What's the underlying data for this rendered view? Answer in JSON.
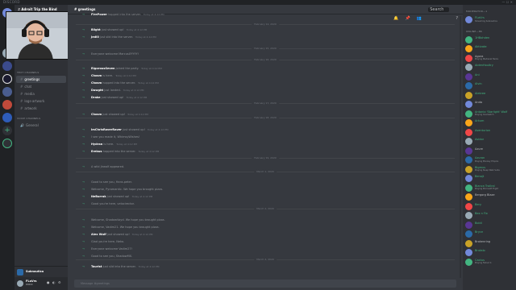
{
  "window": {
    "title": "DISCORD",
    "controls": "— ☐ ✕"
  },
  "server": {
    "name": "ℤ Adroit Trip the Bind"
  },
  "channels": {
    "text_category": "TEXT CHANNELS",
    "text": [
      "greetings",
      "chat",
      "media",
      "logs-artwork",
      "artwork"
    ],
    "voice_category": "VOICE CHANNELS",
    "voice": [
      "General"
    ]
  },
  "now_playing": {
    "name": "Subnautica"
  },
  "user": {
    "name": "FLaVrs",
    "tag": "#0000"
  },
  "chat_header": {
    "channel": "greetings",
    "search_placeholder": "Search"
  },
  "icons": {
    "bell": "bell-icon",
    "pin": "pin-icon",
    "members": "members-icon",
    "help": "help-icon"
  },
  "messages": [
    {
      "user": "FirePower",
      "text": "hopped into the server.",
      "ts": "Today at 4:12 PM"
    },
    {
      "user": "Blight",
      "text": "just showed up!",
      "ts": "Today at 4:12 PM"
    },
    {
      "user": "Jedi0",
      "text": "just slid into the server.",
      "ts": "Today at 4:12 PM"
    },
    {
      "user": "",
      "text": "Everyone welcome MarcusXYYYY!",
      "ts": ""
    },
    {
      "user": "RigorousSeven",
      "text": "joined the party.",
      "ts": "Today at 4:12 PM"
    },
    {
      "user": "Chosm",
      "text": "is here.",
      "ts": "Today at 4:12 PM"
    },
    {
      "user": "Chosm",
      "text": "hopped into the server.",
      "ts": "Today at 4:12 PM"
    },
    {
      "user": "Dawght",
      "text": "just landed.",
      "ts": "Today at 4:12 PM"
    },
    {
      "user": "Drake",
      "text": "just showed up!",
      "ts": "Today at 4:12 PM"
    },
    {
      "user": "Chosm",
      "text": "just showed up!",
      "ts": "Today at 4:12 PM"
    },
    {
      "user": "ImChrisRaverRaver",
      "text": "just showed up!",
      "ts": "Today at 4:12 PM"
    },
    {
      "user": "",
      "text": "I see you made it, WhimsyWishes!",
      "ts": ""
    },
    {
      "user": "Hydran",
      "text": "is here.",
      "ts": "Today at 4:12 PM"
    },
    {
      "user": "Erebus",
      "text": "hopped into the server.",
      "ts": "Today at 4:12 PM"
    },
    {
      "user": "",
      "text": "A wild Jirwolf appeared.",
      "ts": ""
    },
    {
      "user": "",
      "text": "Good to see you, Hans.peter.",
      "ts": ""
    },
    {
      "user": "",
      "text": "Welcome, Pyromantic. We hope you brought pizza.",
      "ts": ""
    },
    {
      "user": "NeBurrak",
      "text": "just showed up!",
      "ts": "Today at 4:12 PM"
    },
    {
      "user": "",
      "text": "Good you're here, velocirector.",
      "ts": ""
    },
    {
      "user": "",
      "text": "Welcome, ShadowVoyd. We hope you brought pizza.",
      "ts": ""
    },
    {
      "user": "",
      "text": "Welcome, Vadim21. We hope you brought pizza.",
      "ts": ""
    },
    {
      "user": "Alex Wulf",
      "text": "just showed up!",
      "ts": "Today at 4:12 PM"
    },
    {
      "user": "",
      "text": "Glad you're here, Neko.",
      "ts": ""
    },
    {
      "user": "",
      "text": "Everyone welcome Vadim27!",
      "ts": ""
    },
    {
      "user": "",
      "text": "Good to see you, ShadowMX.",
      "ts": ""
    },
    {
      "user": "Tourist",
      "text": "just slid into the server.",
      "ts": "Today at 4:12 PM"
    }
  ],
  "dividers": [
    "February 14, 2020",
    "February 15, 2020",
    "February 16, 2020",
    "February 17, 2020",
    "February 18, 2020",
    "February 19, 2020",
    "March 1, 2020",
    "March 2, 2020",
    "March 4, 2020"
  ],
  "composer": {
    "placeholder": "Message #greetings"
  },
  "members": {
    "cat1": "MODERATOR—1",
    "mod": [
      {
        "name": "FLaVrs",
        "status": "Streaming Subnautica"
      }
    ],
    "cat2": "ONLINE—86",
    "online": [
      {
        "name": "1HBohden",
        "status": ""
      },
      {
        "name": "Aktivate",
        "status": ""
      },
      {
        "name": "Agora",
        "status": "Playing Medieval Tanks"
      },
      {
        "name": "AidenHoultry",
        "status": ""
      },
      {
        "name": "Ani",
        "status": ""
      },
      {
        "name": "Alvin",
        "status": ""
      },
      {
        "name": "Alekree",
        "status": ""
      },
      {
        "name": "Anda",
        "status": ""
      },
      {
        "name": "Antonio 'Starlight' Wolf",
        "status": "Playing Overwatch"
      },
      {
        "name": "Arkum",
        "status": ""
      },
      {
        "name": "Aventurion",
        "status": ""
      },
      {
        "name": "Avidor",
        "status": ""
      },
      {
        "name": "Azure",
        "status": ""
      },
      {
        "name": "Azuran",
        "status": "Playing Monkey Empire"
      },
      {
        "name": "Bigmus",
        "status": "Playing Sleep Walk Suite"
      },
      {
        "name": "Benojt",
        "status": ""
      },
      {
        "name": "Bianca Trailral",
        "status": "Playing Microsoft Flight"
      },
      {
        "name": "Bergorg Blaze",
        "status": ""
      },
      {
        "name": "Bery",
        "status": ""
      },
      {
        "name": "Bex n Fix",
        "status": ""
      },
      {
        "name": "Boldi",
        "status": ""
      },
      {
        "name": "Bryce",
        "status": ""
      },
      {
        "name": "Brokenring",
        "status": ""
      },
      {
        "name": "Brutalo",
        "status": ""
      },
      {
        "name": "Cactus",
        "status": "Playing Fallout 4"
      }
    ]
  }
}
